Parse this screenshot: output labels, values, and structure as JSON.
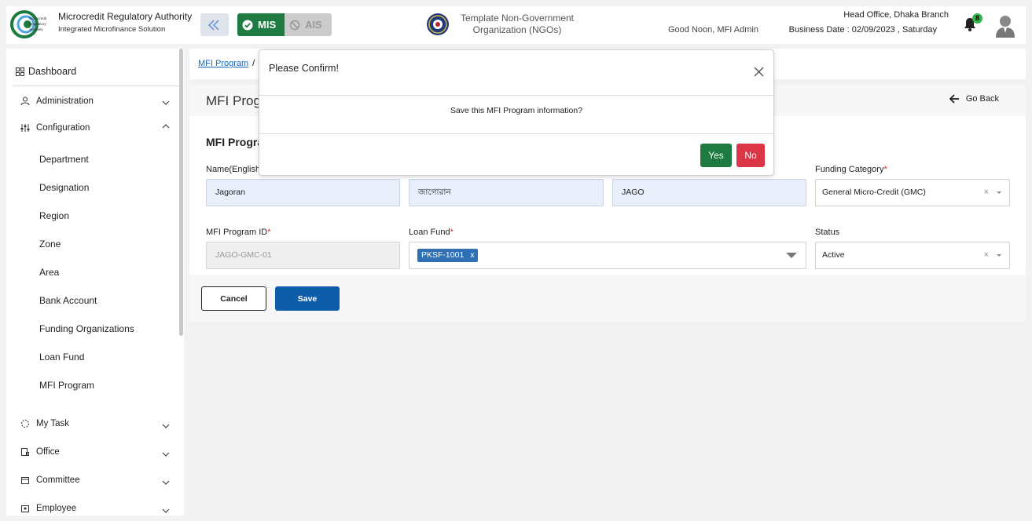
{
  "header": {
    "org_name": "Microcredit Regulatory Authority",
    "org_subtitle": "Integrated Microfinance Solution",
    "logo_text": "Microcredit Regulatory Authority",
    "mis_label": "MIS",
    "ais_label": "AIS",
    "tenant_line1": "Template Non-Government",
    "tenant_line2": "Organization (NGOs)",
    "greeting": "Good Noon, MFI Admin",
    "branch": "Head Office, Dhaka Branch",
    "business_date": "Business Date : 02/09/2023 , Saturday",
    "notification_count": "8",
    "accent_color": "#1d7a40"
  },
  "sidebar": {
    "dashboard": "Dashboard",
    "items": [
      {
        "label": "Administration",
        "icon": "admin-icon",
        "expanded": false
      },
      {
        "label": "Configuration",
        "icon": "sliders-icon",
        "expanded": true
      }
    ],
    "sub_items": [
      "Department",
      "Designation",
      "Region",
      "Zone",
      "Area",
      "Bank Account",
      "Funding Organizations",
      "Loan Fund",
      "MFI Program"
    ],
    "bottom_items": [
      {
        "label": "My Task",
        "icon": "task-icon"
      },
      {
        "label": "Office",
        "icon": "office-icon"
      },
      {
        "label": "Committee",
        "icon": "committee-icon"
      },
      {
        "label": "Employee",
        "icon": "employee-icon"
      }
    ]
  },
  "breadcrumb": {
    "link": "MFI Program",
    "separator": "/"
  },
  "page": {
    "title": "MFI Prog",
    "go_back": "Go Back",
    "section_title": "MFI Progra"
  },
  "form": {
    "name_english_label": "Name(English)",
    "name_english_value": "Jagoran",
    "name_bangla_value": "জাগোরান",
    "short_name_value": "JAGO",
    "funding_category_label": "Funding Category",
    "funding_category_value": "General Micro-Credit (GMC)",
    "program_id_label": "MFI Program ID",
    "program_id_value": "JAGO-GMC-01",
    "loan_fund_label": "Loan Fund",
    "loan_fund_tag": "PKSF-1001",
    "status_label": "Status",
    "status_value": "Active",
    "required_mark": "*",
    "clear_mark": "×",
    "tag_remove": "x"
  },
  "buttons": {
    "cancel": "Cancel",
    "save": "Save"
  },
  "modal": {
    "title": "Please Confirm!",
    "message": "Save this MFI Program information?",
    "yes": "Yes",
    "no": "No"
  }
}
